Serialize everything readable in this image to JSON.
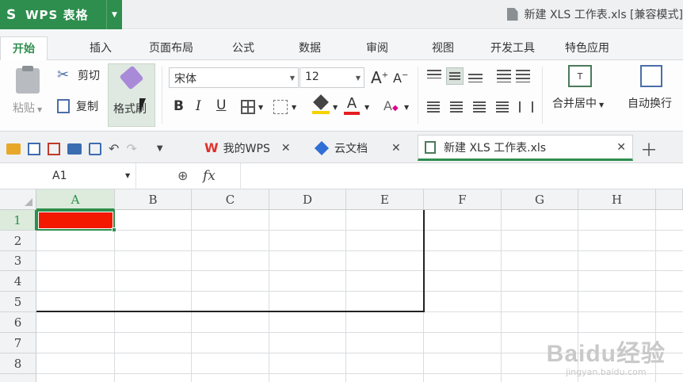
{
  "app": {
    "name": "WPS 表格",
    "logo": "S",
    "accent": "#2d8e4d"
  },
  "window": {
    "title": "新建 XLS 工作表.xls [兼容模式]"
  },
  "ribbon_tabs": [
    "开始",
    "插入",
    "页面布局",
    "公式",
    "数据",
    "审阅",
    "视图",
    "开发工具",
    "特色应用"
  ],
  "clipboard": {
    "paste": "粘贴",
    "cut": "剪切",
    "copy": "复制",
    "format_painter": "格式刷"
  },
  "font": {
    "name": "宋体",
    "size": "12",
    "bold": "B",
    "italic": "I",
    "underline": "U",
    "grow": "A",
    "shrink": "A",
    "fill_color": "#f6d200",
    "font_color": "#e51c23"
  },
  "alignment": {
    "merge_center": "合并居中",
    "wrap_text": "自动换行"
  },
  "doc_tabs": [
    {
      "label": "我的WPS",
      "icon": "wps-logo-icon"
    },
    {
      "label": "云文档",
      "icon": "cloud-doc-icon"
    },
    {
      "label": "新建 XLS 工作表.xls",
      "icon": "xls-file-icon",
      "active": true
    }
  ],
  "formula_bar": {
    "name_box": "A1",
    "fx": "fx",
    "content": ""
  },
  "sheet": {
    "columns": [
      "A",
      "B",
      "C",
      "D",
      "E",
      "F",
      "G",
      "H"
    ],
    "rows": [
      "1",
      "2",
      "3",
      "4",
      "5",
      "6",
      "7",
      "8"
    ],
    "selected_cell": "A1",
    "cell_fill": {
      "A1": "#f31800"
    }
  },
  "watermark": {
    "text": "Baidu经验",
    "url_text": "jingyan.baidu.com"
  }
}
